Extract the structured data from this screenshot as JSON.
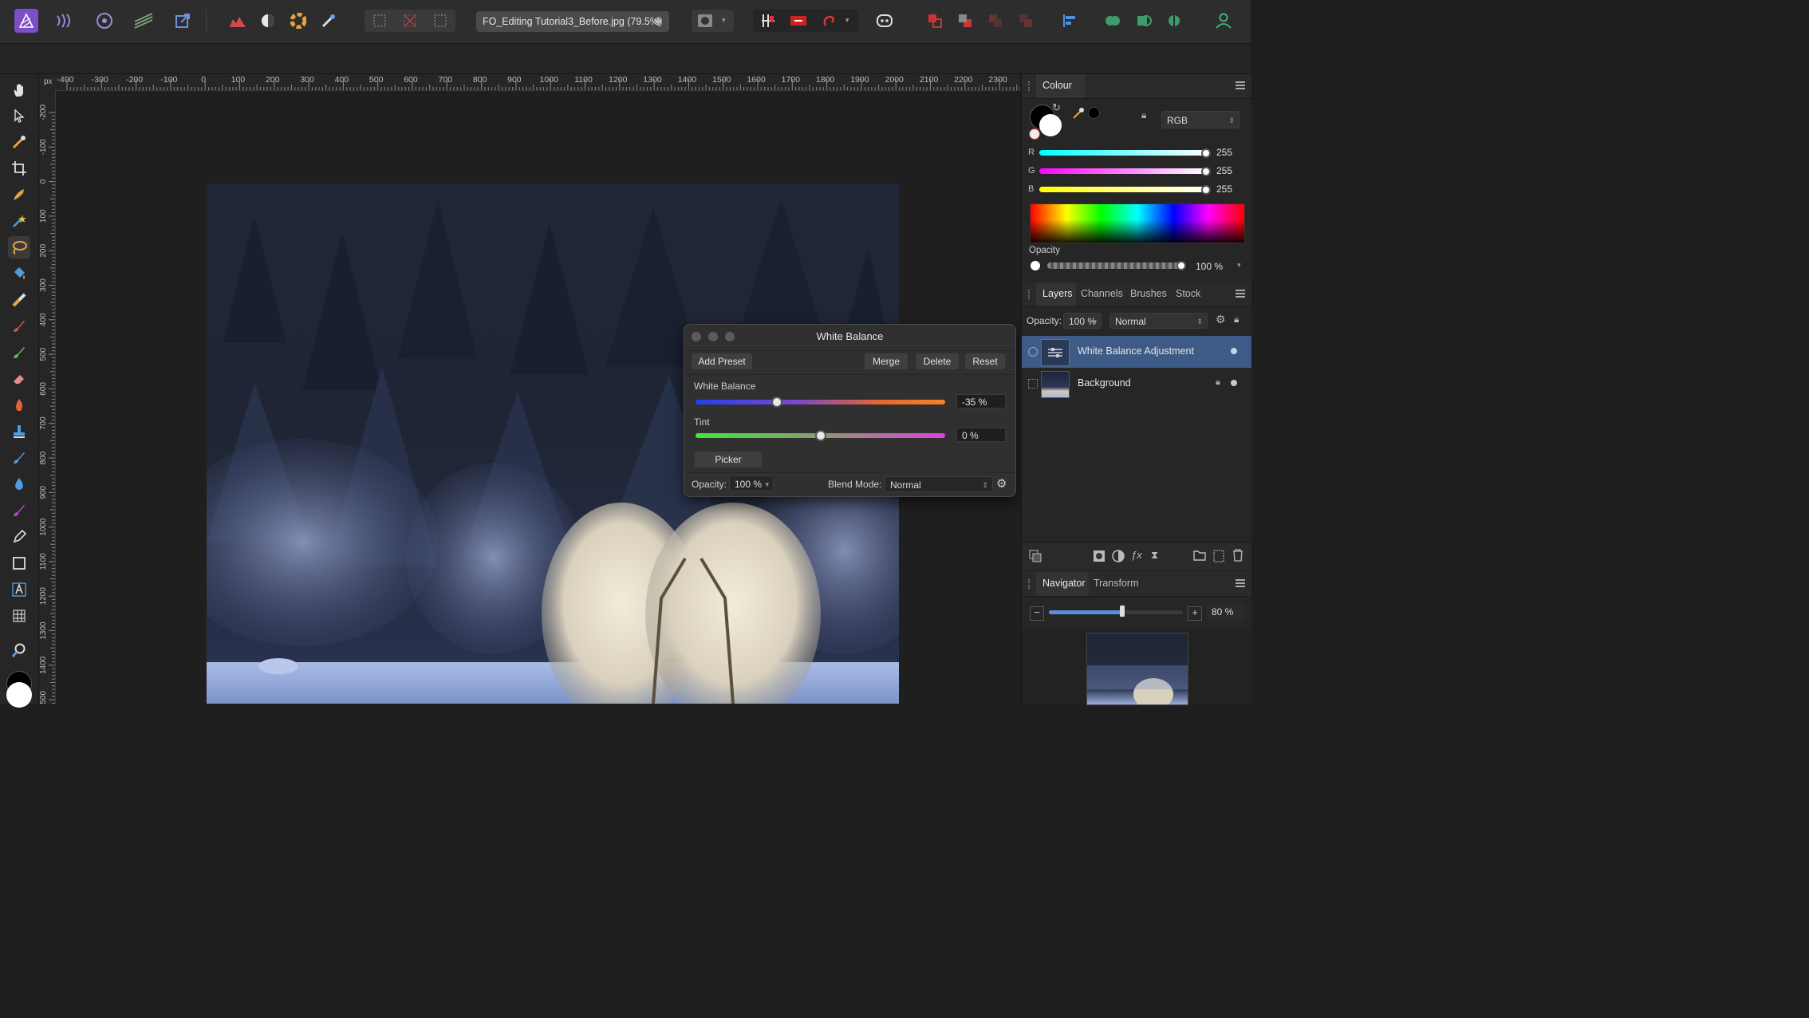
{
  "toolbar": {
    "document_tab": "FO_Editing Tutorial3_Before.jpg (79.5%)",
    "document_close": "✱",
    "icons": [
      "persona-photo-icon",
      "persona-liquify-icon",
      "persona-develop-icon",
      "persona-tone-map-icon",
      "persona-export-icon",
      "histogram-icon",
      "auto-contrast-icon",
      "colour-wheel-icon",
      "white-balance-icon",
      "selection-grid-icon",
      "deselect-icon",
      "marquee-icon",
      "quick-mask-icon",
      "snapping-icon",
      "mirror-icon",
      "undo-redo-icon",
      "assistant-icon",
      "arrange-icons",
      "align-icon",
      "boolean-icons",
      "user-icon"
    ],
    "accent": "#7d4ec4"
  },
  "ruler": {
    "unit": "px",
    "top_labels": [
      "-400",
      "-300",
      "-200",
      "-100",
      "0",
      "100",
      "200",
      "300",
      "400",
      "500",
      "600",
      "700",
      "800",
      "900",
      "1000",
      "1100",
      "1200",
      "1300",
      "1400",
      "1500",
      "1600",
      "1700",
      "1800",
      "1900",
      "2000",
      "2100",
      "2200",
      "2300"
    ],
    "left_labels": [
      "-200",
      "-100",
      "0",
      "100",
      "200",
      "300",
      "400",
      "500",
      "600",
      "700",
      "800",
      "900",
      "1000",
      "1100",
      "1200",
      "1300",
      "1400",
      "1500"
    ]
  },
  "tools": [
    "hand-tool-icon",
    "move-tool-icon",
    "colour-picker-tool-icon",
    "crop-tool-icon",
    "selection-brush-tool-icon",
    "flood-select-tool-icon",
    "freehand-selection-tool-icon",
    "flood-fill-tool-icon",
    "gradient-tool-icon",
    "paint-brush-tool-icon",
    "paint-mixer-tool-icon",
    "erase-brush-tool-icon",
    "dodge-tool-icon",
    "clone-tool-icon",
    "inpainting-tool-icon",
    "blur-tool-icon",
    "red-eye-tool-icon",
    "pen-tool-icon",
    "rectangle-tool-icon",
    "text-tool-icon",
    "mesh-warp-tool-icon",
    "zoom-tool-icon"
  ],
  "dialog": {
    "title": "White Balance",
    "add_preset": "Add Preset",
    "merge": "Merge",
    "delete": "Delete",
    "reset": "Reset",
    "white_balance_label": "White Balance",
    "white_balance_value": "-35 %",
    "white_balance_level": -35,
    "tint_label": "Tint",
    "tint_value": "0 %",
    "tint_level": 0,
    "picker": "Picker",
    "opacity_label": "Opacity:",
    "opacity_value": "100 %",
    "blend_label": "Blend Mode:",
    "blend_value": "Normal"
  },
  "colour_panel": {
    "tab": "Colour",
    "model": "RGB",
    "r_label": "R",
    "r_value": "255",
    "g_label": "G",
    "g_value": "255",
    "b_label": "B",
    "b_value": "255",
    "opacity_label": "Opacity",
    "opacity_value": "100 %"
  },
  "layers_panel": {
    "tabs": [
      "Layers",
      "Channels",
      "Brushes",
      "Stock"
    ],
    "opacity_label": "Opacity:",
    "opacity_value": "100 %",
    "blend_mode": "Normal",
    "layers": [
      {
        "name": "White Balance Adjustment",
        "selected": true
      },
      {
        "name": "Background",
        "selected": false,
        "locked": true
      }
    ]
  },
  "navigator_panel": {
    "tabs": [
      "Navigator",
      "Transform"
    ],
    "zoom_value": "80 %",
    "zoom_level": 0.55
  },
  "colors": {
    "selection": "#3e5a86",
    "panel_bg": "#262626"
  }
}
